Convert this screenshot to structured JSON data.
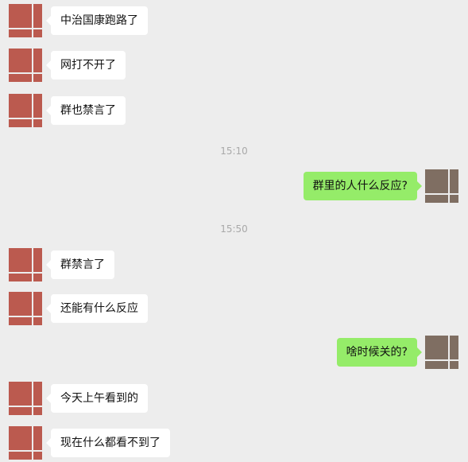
{
  "colors": {
    "background": "#ededed",
    "incoming_bubble": "#ffffff",
    "outgoing_bubble": "#95ec69",
    "incoming_avatar": "#bb5a4f",
    "outgoing_avatar": "#7f6e62",
    "timestamp": "#a9a9a9"
  },
  "messages": [
    {
      "side": "left",
      "text": "中治国康跑路了"
    },
    {
      "side": "left",
      "text": "网打不开了"
    },
    {
      "side": "left",
      "text": "群也禁言了"
    },
    {
      "type": "time",
      "text": "15:10"
    },
    {
      "side": "right",
      "text": "群里的人什么反应?"
    },
    {
      "type": "time",
      "text": "15:50"
    },
    {
      "side": "left",
      "text": "群禁言了"
    },
    {
      "side": "left",
      "text": "还能有什么反应"
    },
    {
      "side": "right",
      "text": "啥时候关的?"
    },
    {
      "side": "left",
      "text": "今天上午看到的"
    },
    {
      "side": "left",
      "text": "现在什么都看不到了"
    }
  ]
}
